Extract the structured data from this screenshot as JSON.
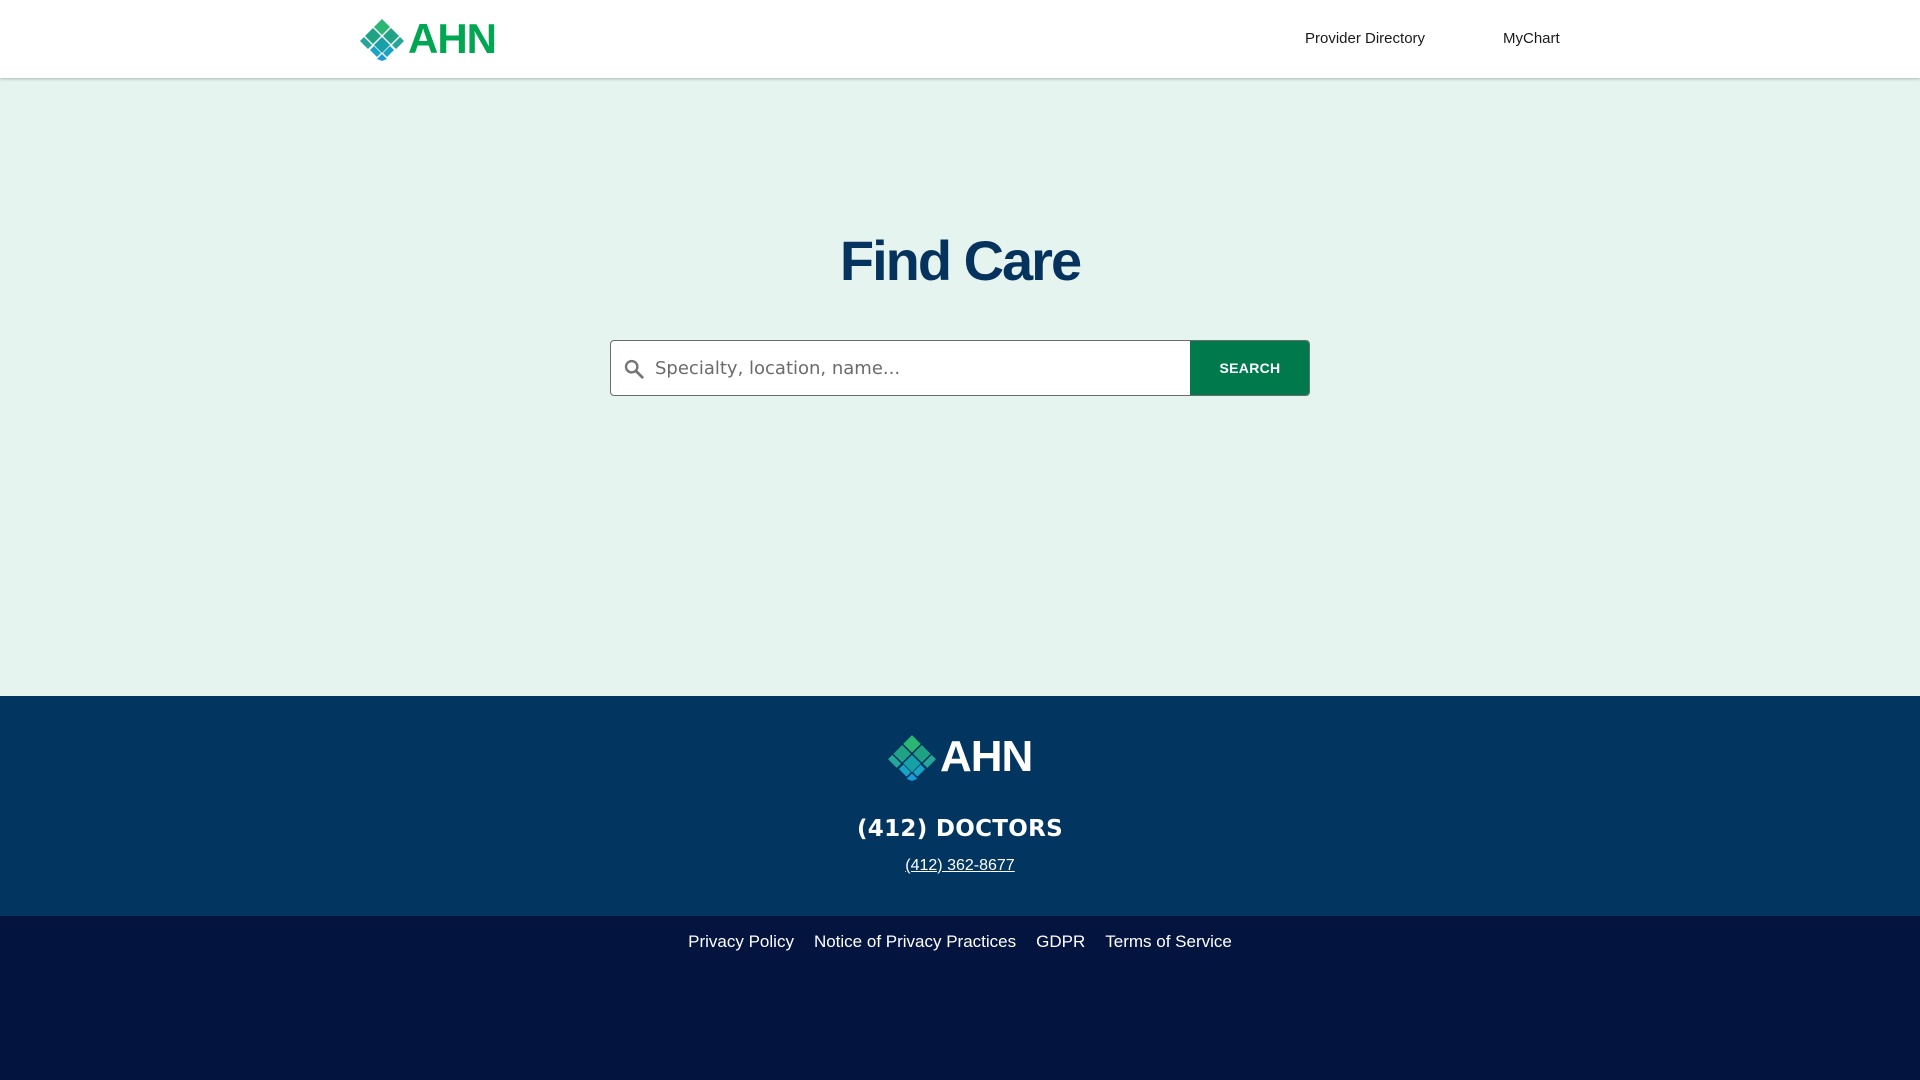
{
  "header": {
    "logo_text": "AHN",
    "nav": {
      "provider_directory": "Provider Directory",
      "mychart": "MyChart"
    }
  },
  "hero": {
    "title": "Find Care",
    "search": {
      "placeholder": "Specialty, location, name...",
      "value": "",
      "button_label": "SEARCH"
    }
  },
  "footer": {
    "logo_text": "AHN",
    "phone_name": "(412) DOCTORS",
    "phone_number": "(412) 362-8677",
    "links": {
      "privacy_policy": "Privacy Policy",
      "notice_privacy": "Notice of Privacy Practices",
      "gdpr": "GDPR",
      "terms": "Terms of Service"
    }
  },
  "colors": {
    "brand_green": "#00a651",
    "search_button": "#007a4d",
    "hero_bg": "#e5f4ee",
    "title_navy": "#05335e",
    "footer_top": "#023661",
    "footer_bottom": "#03143f"
  },
  "icons": {
    "logo_mark": "diamond-cluster-logo-icon",
    "search": "magnifier-search-icon"
  }
}
